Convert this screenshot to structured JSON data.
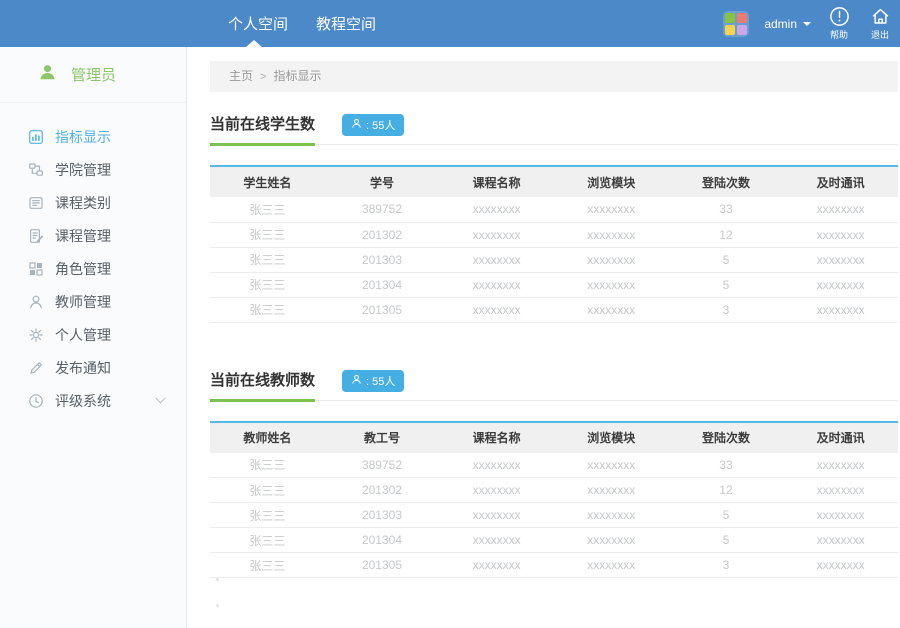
{
  "header": {
    "tabs": [
      {
        "label": "个人空间",
        "active": true
      },
      {
        "label": "教程空间",
        "active": false
      }
    ],
    "user_name": "admin",
    "help_label": "帮助",
    "logout_label": "退出"
  },
  "sidebar": {
    "role": "管理员",
    "items": [
      {
        "id": "indicators",
        "label": "指标显示",
        "icon": "bar-chart-icon",
        "active": true
      },
      {
        "id": "college",
        "label": "学院管理",
        "icon": "org-chart-icon",
        "active": false
      },
      {
        "id": "category",
        "label": "课程类别",
        "icon": "list-icon",
        "active": false
      },
      {
        "id": "course",
        "label": "课程管理",
        "icon": "document-edit-icon",
        "active": false
      },
      {
        "id": "role",
        "label": "角色管理",
        "icon": "grid-icon",
        "active": false
      },
      {
        "id": "teacher",
        "label": "教师管理",
        "icon": "person-icon",
        "active": false
      },
      {
        "id": "profile",
        "label": "个人管理",
        "icon": "gear-icon",
        "active": false
      },
      {
        "id": "notice",
        "label": "发布通知",
        "icon": "pencil-icon",
        "active": false
      },
      {
        "id": "rating",
        "label": "评级系统",
        "icon": "clock-icon",
        "active": false,
        "expandable": true
      }
    ]
  },
  "breadcrumb": {
    "items": [
      "主页",
      "指标显示"
    ],
    "separator": ">"
  },
  "sections": [
    {
      "title": "当前在线学生数",
      "badge_text": ": 55人",
      "table": {
        "headers": [
          "学生姓名",
          "学号",
          "课程名称",
          "浏览模块",
          "登陆次数",
          "及时通讯"
        ],
        "rows": [
          [
            "张三三",
            "389752",
            "xxxxxxxx",
            "xxxxxxxx",
            "33",
            "xxxxxxxx"
          ],
          [
            "张三三",
            "201302",
            "xxxxxxxx",
            "xxxxxxxx",
            "12",
            "xxxxxxxx"
          ],
          [
            "张三三",
            "201303",
            "xxxxxxxx",
            "xxxxxxxx",
            "5",
            "xxxxxxxx"
          ],
          [
            "张三三",
            "201304",
            "xxxxxxxx",
            "xxxxxxxx",
            "5",
            "xxxxxxxx"
          ],
          [
            "张三三",
            "201305",
            "xxxxxxxx",
            "xxxxxxxx",
            "3",
            "xxxxxxxx"
          ]
        ]
      }
    },
    {
      "title": "当前在线教师数",
      "badge_text": ": 55人",
      "table": {
        "headers": [
          "教师姓名",
          "教工号",
          "课程名称",
          "浏览模块",
          "登陆次数",
          "及时通讯"
        ],
        "rows": [
          [
            "张三三",
            "389752",
            "xxxxxxxx",
            "xxxxxxxx",
            "33",
            "xxxxxxxx"
          ],
          [
            "张三三",
            "201302",
            "xxxxxxxx",
            "xxxxxxxx",
            "12",
            "xxxxxxxx"
          ],
          [
            "张三三",
            "201303",
            "xxxxxxxx",
            "xxxxxxxx",
            "5",
            "xxxxxxxx"
          ],
          [
            "张三三",
            "201304",
            "xxxxxxxx",
            "xxxxxxxx",
            "5",
            "xxxxxxxx"
          ],
          [
            "张三三",
            "201305",
            "xxxxxxxx",
            "xxxxxxxx",
            "3",
            "xxxxxxxx"
          ]
        ]
      }
    }
  ],
  "colors": {
    "header_blue": "#4b89c8",
    "accent_blue": "#52b2e4",
    "badge_blue": "#45aee3",
    "table_border_blue": "#56b8e8",
    "green": "#8bc767",
    "underline_green": "#7dc353",
    "sidebar_bg": "#fafbfc",
    "app_green": "#86c440",
    "app_red": "#ef7a70",
    "app_yellow": "#f6d44d",
    "app_purple": "#c9a7e8"
  }
}
